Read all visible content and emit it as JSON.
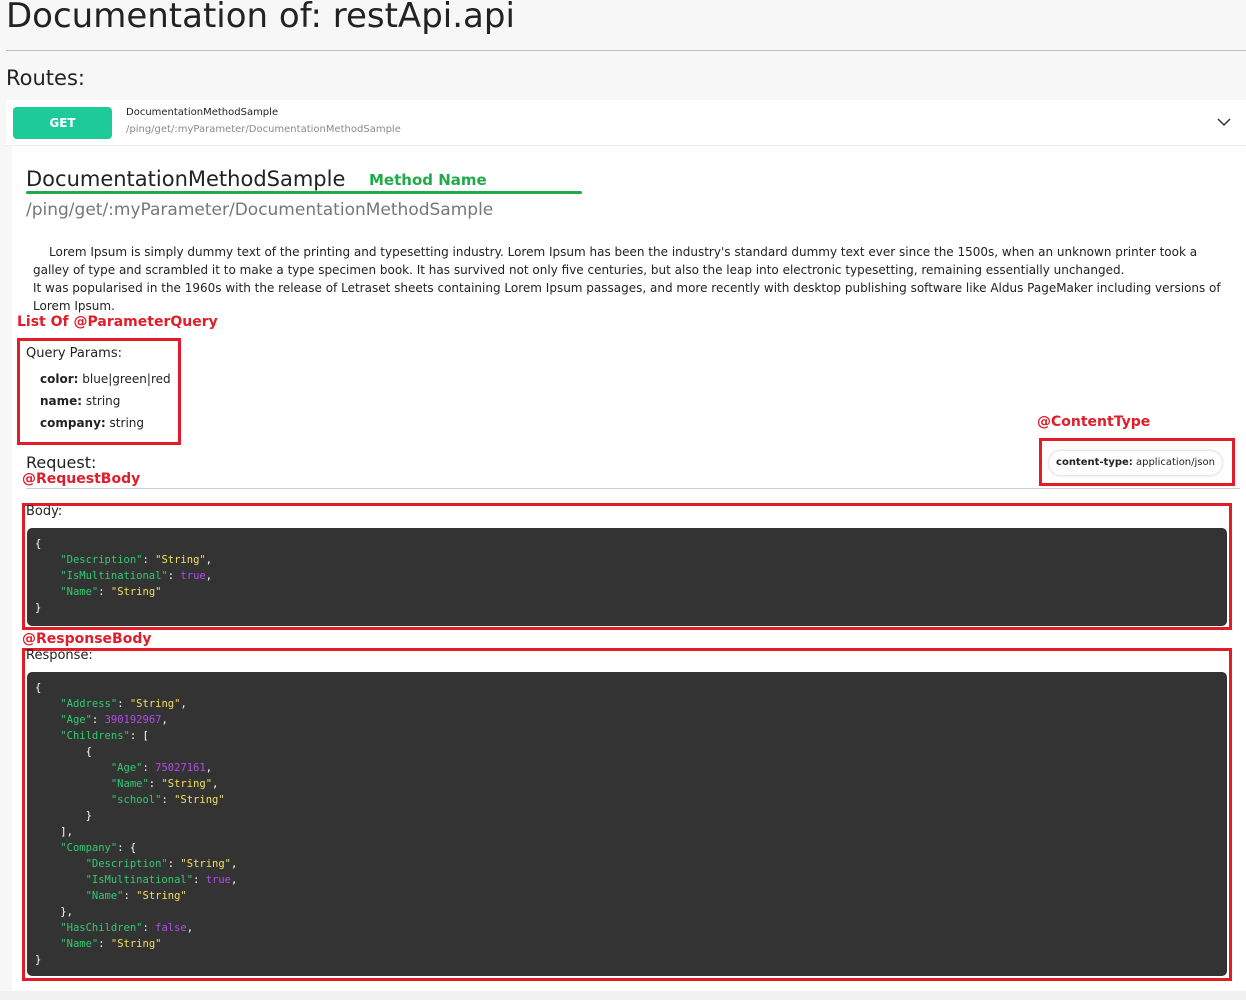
{
  "page": {
    "title": "Documentation of: restApi.api",
    "routes_heading": "Routes:"
  },
  "route": {
    "method": "GET",
    "name": "DocumentationMethodSample",
    "path": "/ping/get/:myParameter/DocumentationMethodSample"
  },
  "detail": {
    "method_title": "DocumentationMethodSample",
    "method_path": "/ping/get/:myParameter/DocumentationMethodSample",
    "description_1": "Lorem Ipsum is simply dummy text of the printing and typesetting industry. Lorem Ipsum has been the industry's standard dummy text ever since the 1500s, when an unknown printer took a galley of type and scrambled it to make a type specimen book. It has survived not only five centuries, but also the leap into electronic typesetting, remaining essentially unchanged.",
    "description_2": "It was popularised in the 1960s with the release of Letraset sheets containing Lorem Ipsum passages, and more recently with desktop publishing software like Aldus PageMaker including versions of Lorem Ipsum."
  },
  "annotations": {
    "method_name": "Method Name",
    "parameter_query": "List Of @ParameterQuery",
    "content_type": "@ContentType",
    "request_body": "@RequestBody",
    "response_body": "@ResponseBody"
  },
  "query_params": {
    "title": "Query Params:",
    "items": [
      {
        "name": "color:",
        "type": "blue|green|red"
      },
      {
        "name": "name:",
        "type": "string"
      },
      {
        "name": "company:",
        "type": "string"
      }
    ]
  },
  "request": {
    "title": "Request:",
    "content_type_label": "content-type:",
    "content_type_value": "application/json",
    "body_label": "Body:",
    "body_lines": [
      [
        [
          "p",
          "{"
        ]
      ],
      [
        [
          "p",
          "    "
        ],
        [
          "k",
          "\"Description\""
        ],
        [
          "p",
          ": "
        ],
        [
          "s",
          "\"String\""
        ],
        [
          "p",
          ","
        ]
      ],
      [
        [
          "p",
          "    "
        ],
        [
          "k",
          "\"IsMultinational\""
        ],
        [
          "p",
          ": "
        ],
        [
          "n",
          "true"
        ],
        [
          "p",
          ","
        ]
      ],
      [
        [
          "p",
          "    "
        ],
        [
          "k",
          "\"Name\""
        ],
        [
          "p",
          ": "
        ],
        [
          "s",
          "\"String\""
        ]
      ],
      [
        [
          "p",
          "}"
        ]
      ]
    ]
  },
  "response": {
    "label": "Response:",
    "body_lines": [
      [
        [
          "p",
          "{"
        ]
      ],
      [
        [
          "p",
          "    "
        ],
        [
          "k",
          "\"Address\""
        ],
        [
          "p",
          ": "
        ],
        [
          "s",
          "\"String\""
        ],
        [
          "p",
          ","
        ]
      ],
      [
        [
          "p",
          "    "
        ],
        [
          "k",
          "\"Age\""
        ],
        [
          "p",
          ": "
        ],
        [
          "n",
          "390192967"
        ],
        [
          "p",
          ","
        ]
      ],
      [
        [
          "p",
          "    "
        ],
        [
          "k",
          "\"Childrens\""
        ],
        [
          "p",
          ": ["
        ]
      ],
      [
        [
          "p",
          "        {"
        ]
      ],
      [
        [
          "p",
          "            "
        ],
        [
          "k",
          "\"Age\""
        ],
        [
          "p",
          ": "
        ],
        [
          "n",
          "75027161"
        ],
        [
          "p",
          ","
        ]
      ],
      [
        [
          "p",
          "            "
        ],
        [
          "k",
          "\"Name\""
        ],
        [
          "p",
          ": "
        ],
        [
          "s",
          "\"String\""
        ],
        [
          "p",
          ","
        ]
      ],
      [
        [
          "p",
          "            "
        ],
        [
          "k",
          "\"school\""
        ],
        [
          "p",
          ": "
        ],
        [
          "s",
          "\"String\""
        ]
      ],
      [
        [
          "p",
          "        }"
        ]
      ],
      [
        [
          "p",
          "    ],"
        ]
      ],
      [
        [
          "p",
          "    "
        ],
        [
          "k",
          "\"Company\""
        ],
        [
          "p",
          ": {"
        ]
      ],
      [
        [
          "p",
          "        "
        ],
        [
          "k",
          "\"Description\""
        ],
        [
          "p",
          ": "
        ],
        [
          "s",
          "\"String\""
        ],
        [
          "p",
          ","
        ]
      ],
      [
        [
          "p",
          "        "
        ],
        [
          "k",
          "\"IsMultinational\""
        ],
        [
          "p",
          ": "
        ],
        [
          "n",
          "true"
        ],
        [
          "p",
          ","
        ]
      ],
      [
        [
          "p",
          "        "
        ],
        [
          "k",
          "\"Name\""
        ],
        [
          "p",
          ": "
        ],
        [
          "s",
          "\"String\""
        ]
      ],
      [
        [
          "p",
          "    },"
        ]
      ],
      [
        [
          "p",
          "    "
        ],
        [
          "k",
          "\"HasChildren\""
        ],
        [
          "p",
          ": "
        ],
        [
          "n",
          "false"
        ],
        [
          "p",
          ","
        ]
      ],
      [
        [
          "p",
          "    "
        ],
        [
          "k",
          "\"Name\""
        ],
        [
          "p",
          ": "
        ],
        [
          "s",
          "\"String\""
        ]
      ],
      [
        [
          "p",
          "}"
        ]
      ]
    ]
  },
  "colors": {
    "get_badge": "#1ec99a",
    "json_key": "#2ecc71",
    "json_string": "#f1e05a",
    "json_literal": "#b04ce8",
    "annotation_red": "#e11d2a",
    "annotation_green": "#22aa4a",
    "code_background": "#333333"
  },
  "icons": {
    "expand": "chevron-down-icon"
  }
}
